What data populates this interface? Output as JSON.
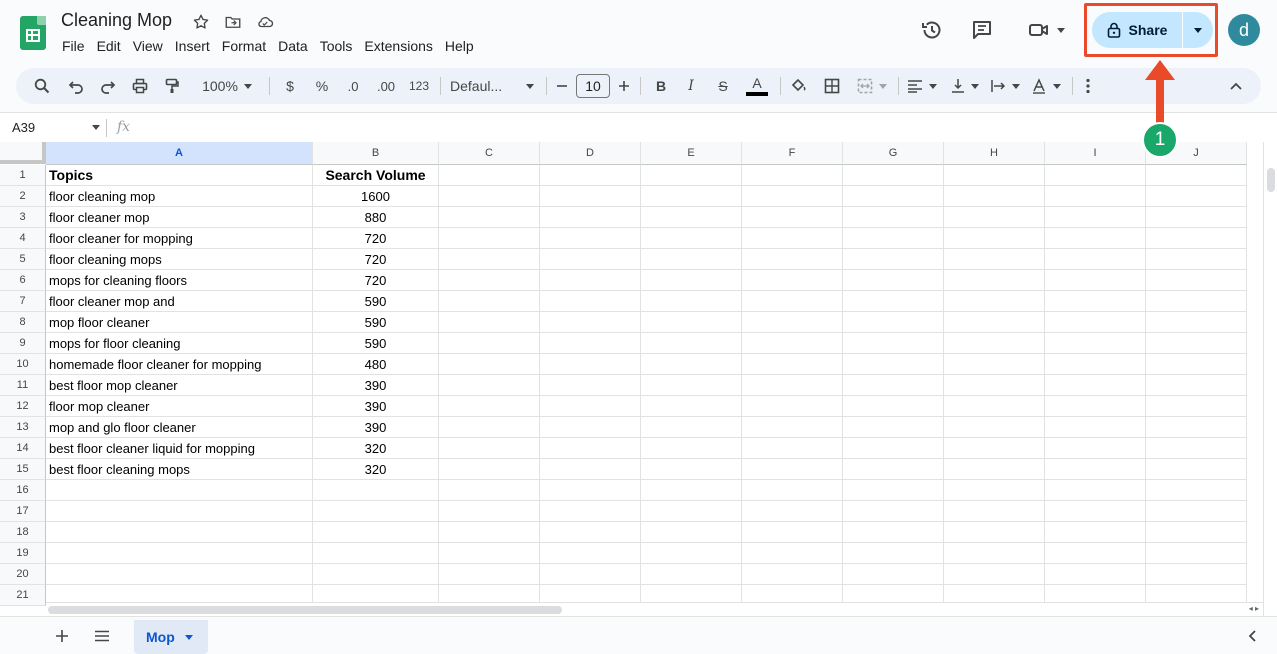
{
  "doc": {
    "title": "Cleaning Mop"
  },
  "menu": [
    "File",
    "Edit",
    "View",
    "Insert",
    "Format",
    "Data",
    "Tools",
    "Extensions",
    "Help"
  ],
  "share": {
    "label": "Share"
  },
  "user": {
    "initial": "d"
  },
  "annotation": {
    "step": "1"
  },
  "toolbar": {
    "zoom": "100%",
    "currency": "$",
    "percent": "%",
    "decrease_decimal": ".0",
    "increase_decimal": ".00",
    "number_format": "123",
    "font": "Defaul...",
    "font_size": "10",
    "bold": "B",
    "italic": "I",
    "strike": "S",
    "text_color": "A"
  },
  "formula_bar": {
    "name_box": "A39",
    "fx": "fx"
  },
  "grid": {
    "columns": [
      "A",
      "B",
      "C",
      "D",
      "E",
      "F",
      "G",
      "H",
      "I",
      "J"
    ],
    "selected_column": "A",
    "row_numbers": [
      "1",
      "2",
      "3",
      "4",
      "5",
      "6",
      "7",
      "8",
      "9",
      "10",
      "11",
      "12",
      "13",
      "14",
      "15",
      "16",
      "17",
      "18",
      "19",
      "20",
      "21"
    ],
    "rows": [
      [
        "Topics",
        "Search Volume"
      ],
      [
        "floor cleaning mop",
        "1600"
      ],
      [
        "floor cleaner mop",
        "880"
      ],
      [
        "floor cleaner for mopping",
        "720"
      ],
      [
        "floor cleaning mops",
        "720"
      ],
      [
        "mops for cleaning floors",
        "720"
      ],
      [
        "floor cleaner mop and",
        "590"
      ],
      [
        "mop floor cleaner",
        "590"
      ],
      [
        "mops for floor cleaning",
        "590"
      ],
      [
        "homemade floor cleaner for mopping",
        "480"
      ],
      [
        "best floor mop cleaner",
        "390"
      ],
      [
        "floor mop cleaner",
        "390"
      ],
      [
        "mop and glo floor cleaner",
        "390"
      ],
      [
        "best floor cleaner liquid for mopping",
        "320"
      ],
      [
        "best floor cleaning mops",
        "320"
      ]
    ]
  },
  "sheets": {
    "active": "Mop"
  },
  "colors": {
    "accent": "#0b57d0",
    "share_bg": "#c2e7ff",
    "highlight": "#e94a2a",
    "step_badge": "#1aa76a",
    "sheets_green": "#23a566"
  }
}
